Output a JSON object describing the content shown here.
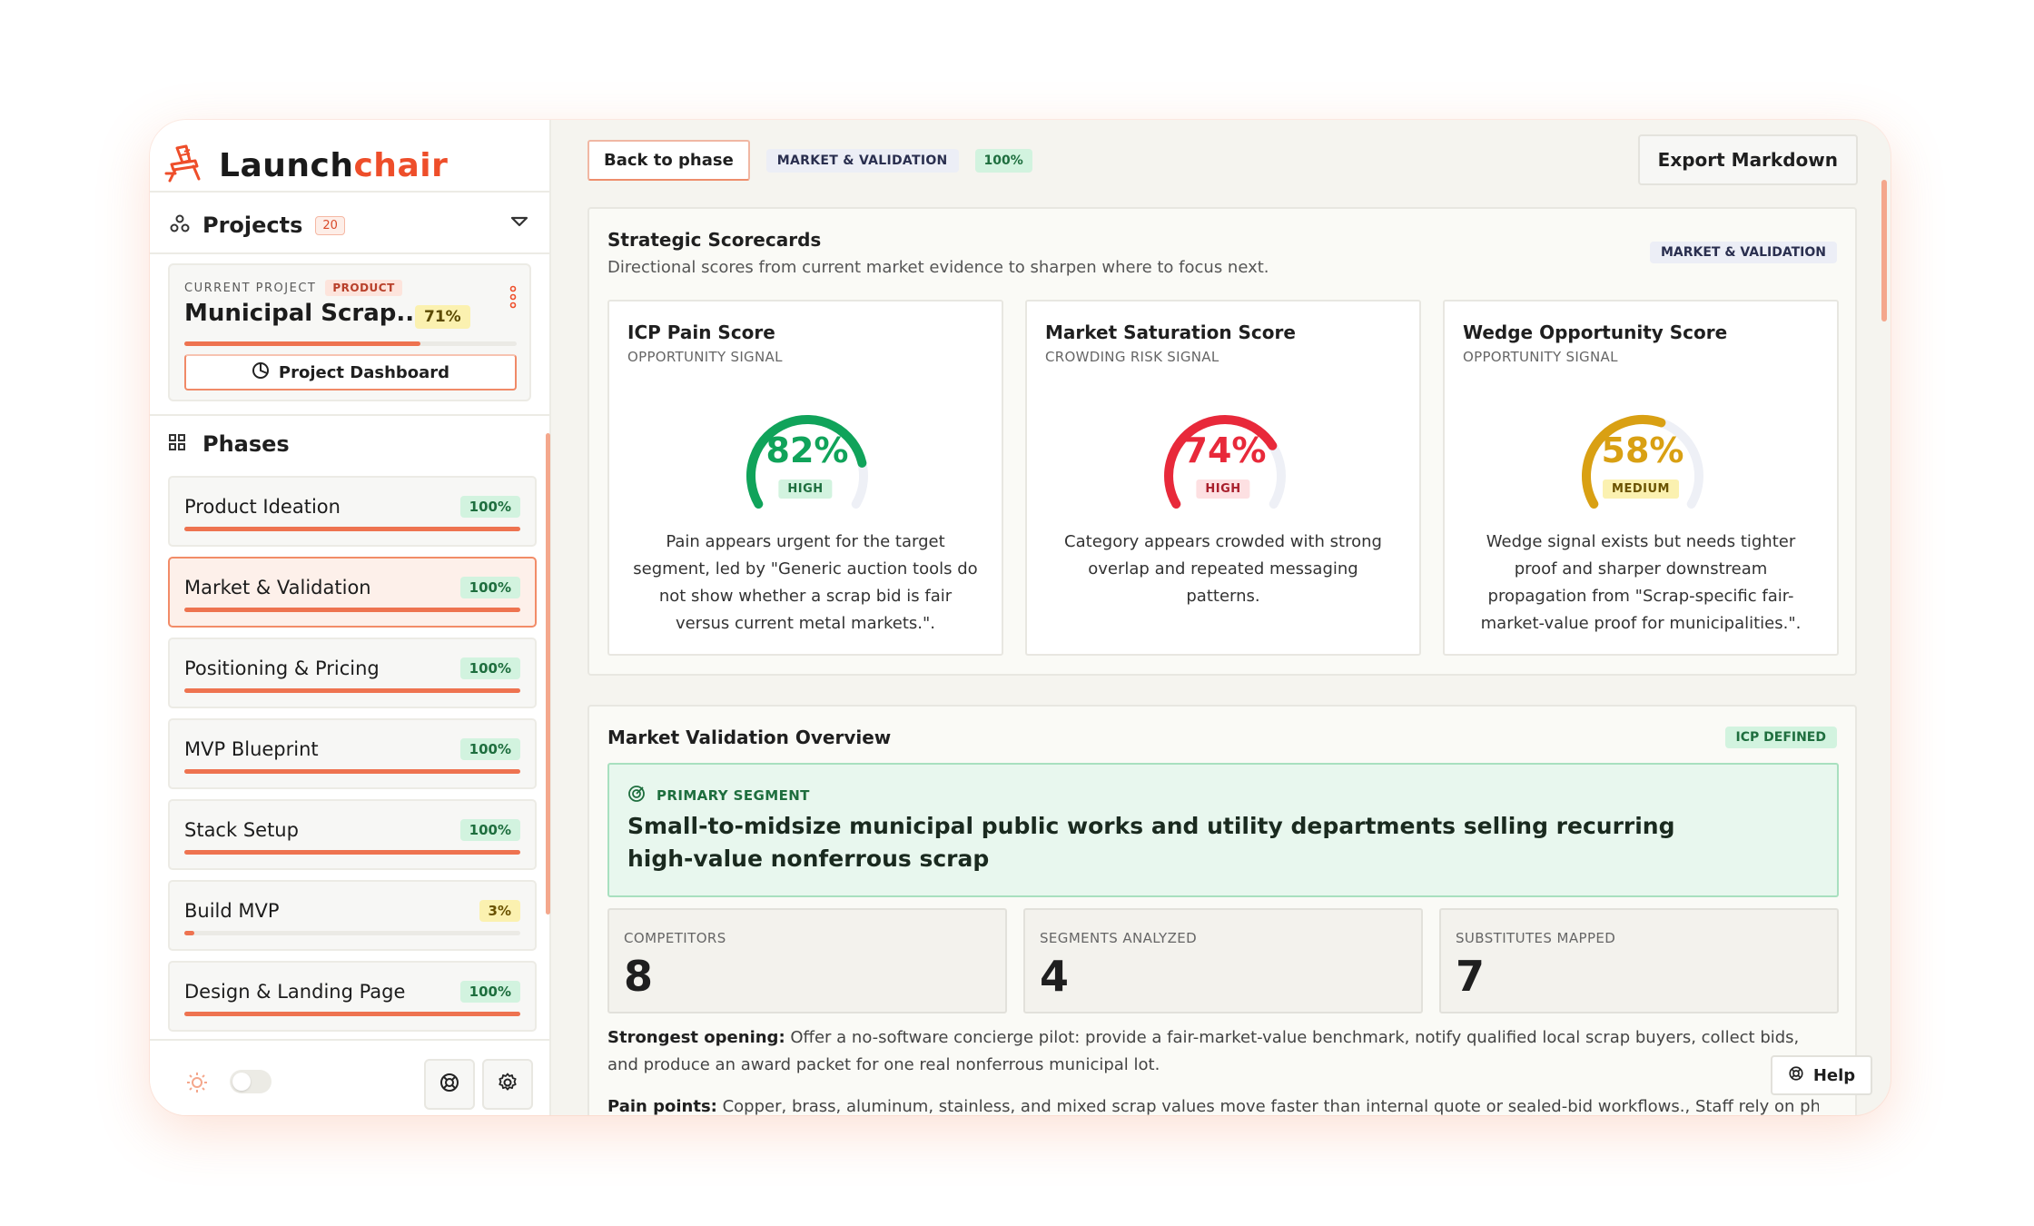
{
  "app": {
    "logo_dark": "Launch",
    "logo_accent": "chair"
  },
  "colors": {
    "accent": "#ee4e2a",
    "green": "#10a35a",
    "red": "#e8293a",
    "amber": "#d9a013"
  },
  "sidebar": {
    "projects_label": "Projects",
    "projects_count": "20",
    "current_project": {
      "label": "CURRENT PROJECT",
      "tag": "PRODUCT",
      "name": "Municipal Scrap...",
      "percent": "71%",
      "progress": 0.71,
      "dashboard_button": "Project Dashboard"
    },
    "phases_label": "Phases",
    "phases": [
      {
        "label": "Product Ideation",
        "percent": "100%",
        "progress": 1.0
      },
      {
        "label": "Market & Validation",
        "percent": "100%",
        "progress": 1.0
      },
      {
        "label": "Positioning & Pricing",
        "percent": "100%",
        "progress": 1.0
      },
      {
        "label": "MVP Blueprint",
        "percent": "100%",
        "progress": 1.0
      },
      {
        "label": "Stack Setup",
        "percent": "100%",
        "progress": 1.0
      },
      {
        "label": "Build MVP",
        "percent": "3%",
        "progress": 0.03
      },
      {
        "label": "Design & Landing Page",
        "percent": "100%",
        "progress": 1.0
      }
    ]
  },
  "toolbar": {
    "back_label": "Back to phase",
    "phase_badge": "MARKET & VALIDATION",
    "phase_percent": "100%",
    "export_label": "Export Markdown"
  },
  "scorecards": {
    "title": "Strategic Scorecards",
    "subtitle": "Directional scores from current market evidence to sharpen where to focus next.",
    "badge": "MARKET & VALIDATION",
    "cards": [
      {
        "title": "ICP Pain Score",
        "subtitle": "OPPORTUNITY SIGNAL",
        "value": "82%",
        "fraction": 0.82,
        "level": "HIGH",
        "color": "#10a35a",
        "description": "Pain appears urgent for the target segment, led by \"Generic auction tools do not show whether a scrap bid is fair versus current metal markets.\"."
      },
      {
        "title": "Market Saturation Score",
        "subtitle": "CROWDING RISK SIGNAL",
        "value": "74%",
        "fraction": 0.74,
        "level": "HIGH",
        "color": "#e8293a",
        "description": "Category appears crowded with strong overlap and repeated messaging patterns."
      },
      {
        "title": "Wedge Opportunity Score",
        "subtitle": "OPPORTUNITY SIGNAL",
        "value": "58%",
        "fraction": 0.58,
        "level": "MEDIUM",
        "color": "#d9a013",
        "description": "Wedge signal exists but needs tighter proof and sharper downstream propagation from \"Scrap-specific fair-market-value proof for municipalities.\"."
      }
    ]
  },
  "overview": {
    "title": "Market Validation Overview",
    "badge": "ICP DEFINED",
    "primary_segment_label": "PRIMARY SEGMENT",
    "primary_segment": "Small-to-midsize municipal public works and utility departments selling recurring high-value nonferrous scrap",
    "stats": [
      {
        "label": "COMPETITORS",
        "value": "8"
      },
      {
        "label": "SEGMENTS ANALYZED",
        "value": "4"
      },
      {
        "label": "SUBSTITUTES MAPPED",
        "value": "7"
      }
    ],
    "strongest_label": "Strongest opening:",
    "strongest_text": "Offer a no-software concierge pilot: provide a fair-market-value benchmark, notify qualified local scrap buyers, collect bids, and produce an award packet for one real nonferrous municipal lot.",
    "pain_label": "Pain points:",
    "pain_text": "Copper, brass, aluminum, stainless, and mixed scrap values move faster than internal quote or sealed-bid workflows., Staff rely on phone"
  },
  "help_label": "Help"
}
